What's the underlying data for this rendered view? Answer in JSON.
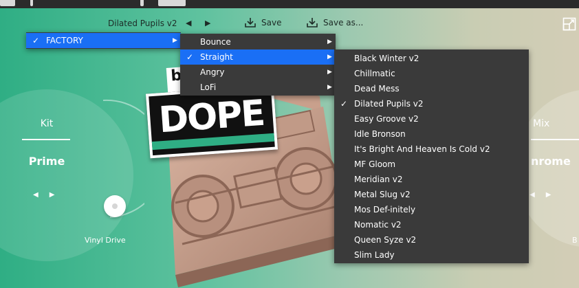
{
  "header": {
    "preset_name": "Dilated Pupils v2",
    "prev_arrow": "◀",
    "next_arrow": "▶",
    "save_label": "Save",
    "save_as_label": "Save as..."
  },
  "kit": {
    "label": "Kit",
    "value": "Prime",
    "prev": "◀",
    "next": "▶"
  },
  "mix": {
    "label": "Mix",
    "value": "nrome",
    "prev": "◀",
    "next": "▶"
  },
  "drive": {
    "label": "Vinyl Drive"
  },
  "right_partial_label": "B",
  "sticker": {
    "text": "DOPE",
    "tab_letter": "b"
  },
  "menus": {
    "root": {
      "items": [
        {
          "label": "FACTORY",
          "checked": true,
          "selected": true
        }
      ]
    },
    "categories": {
      "items": [
        {
          "label": "Bounce"
        },
        {
          "label": "Straight",
          "checked": true,
          "selected": true
        },
        {
          "label": "Angry"
        },
        {
          "label": "LoFi"
        }
      ]
    },
    "presets": {
      "items": [
        {
          "label": "Black Winter v2"
        },
        {
          "label": "Chillmatic"
        },
        {
          "label": "Dead Mess"
        },
        {
          "label": "Dilated Pupils v2",
          "checked": true
        },
        {
          "label": "Easy Groove v2"
        },
        {
          "label": "Idle Bronson"
        },
        {
          "label": "It's Bright And Heaven Is Cold v2"
        },
        {
          "label": "MF Gloom"
        },
        {
          "label": "Meridian v2"
        },
        {
          "label": "Metal Slug v2"
        },
        {
          "label": "Mos Def-initely"
        },
        {
          "label": "Nomatic v2"
        },
        {
          "label": "Queen Syze v2"
        },
        {
          "label": "Slim Lady"
        }
      ]
    }
  },
  "glyphs": {
    "check": "✓",
    "submenu": "▶"
  },
  "colors": {
    "menu_bg": "#3a3a3a",
    "selection": "#1a6ff5",
    "accent_green": "#2fae84"
  }
}
